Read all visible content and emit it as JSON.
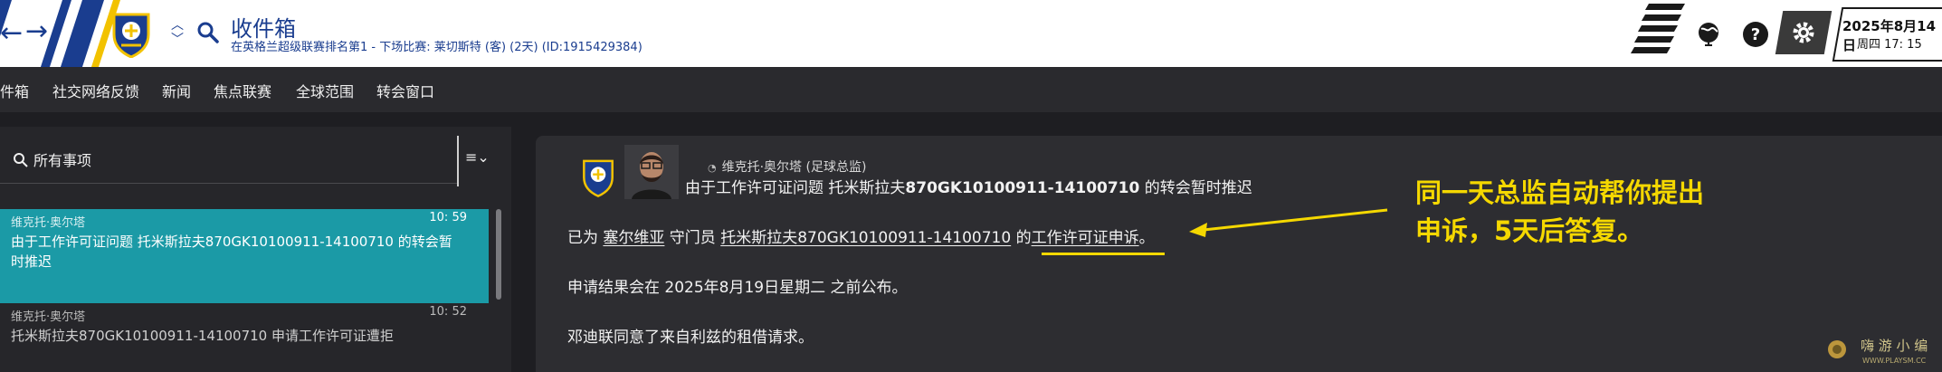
{
  "header": {
    "back_icon": "arrow-left-icon",
    "forward_icon": "arrow-right-icon",
    "title": "收件箱",
    "subtitle": "在英格兰超级联赛排名第1 - 下场比赛: 莱切斯特 (客) (2天) (ID:1915429384)",
    "date": "2025年8月14日",
    "day_time": "周四 17: 15",
    "accent": "#1a3d8f",
    "stripe_yellow": "#f2c200"
  },
  "nav": {
    "items": [
      "件箱",
      "社交网络反馈",
      "新闻",
      "焦点联赛",
      "全球范围",
      "转会窗口"
    ]
  },
  "filter": {
    "label": "所有事项",
    "menu_icon": "list-chevron-icon"
  },
  "messages": [
    {
      "sender": "维克托·奥尔塔",
      "time": "10: 59",
      "text": "由于工作许可证问题 托米斯拉夫870GK10100911-14100710 的转会暂时推迟",
      "selected": true,
      "highlight": "#1b9aa6"
    },
    {
      "sender": "维克托·奥尔塔",
      "time": "10: 52",
      "text": "托米斯拉夫870GK10100911-14100710 申请工作许可证遭拒",
      "selected": false
    }
  ],
  "detail": {
    "sender": "维克托·奥尔塔 (足球总监)",
    "subject_prefix": "由于工作许可证问题 托米斯拉夫",
    "subject_bold": "870GK10100911-14100710",
    "subject_suffix": " 的转会暂时推迟",
    "body_1_prefix": "已为 ",
    "body_1_link1": "塞尔维亚",
    "body_1_mid": " 守门员 ",
    "body_1_link2": "托米斯拉夫870GK10100911-14100710",
    "body_1_mid2": " 的",
    "body_1_link3": "工作许可证申诉",
    "body_1_end": "。",
    "body_2": "申请结果会在 2025年8月19日星期二 之前公布。",
    "body_3": "邓迪联同意了来自利兹的租借请求。"
  },
  "annotation": {
    "line1": "同一天总监自动帮你提出",
    "line2": "申诉，5天后答复。",
    "color": "#f5d800"
  },
  "watermark": {
    "text": "嗨 游 小 编",
    "sub": "WWW.PLAYSM.CC"
  }
}
